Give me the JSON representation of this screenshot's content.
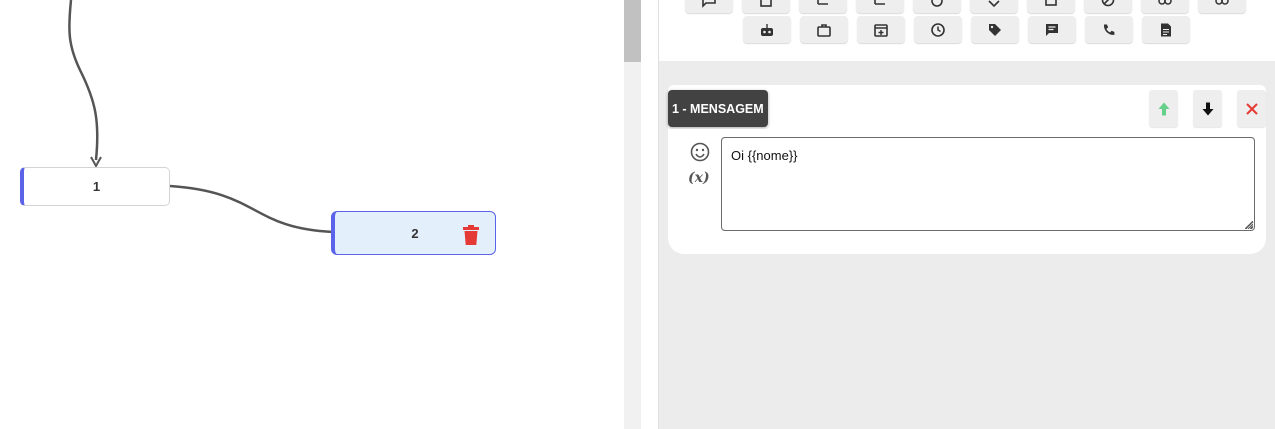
{
  "flow": {
    "nodes": [
      {
        "label": "1"
      },
      {
        "label": "2"
      }
    ]
  },
  "editor": {
    "block_title": "1 - MENSAGEM",
    "message_value": "Oi {{nome}}",
    "variable_label": "(x)"
  },
  "colors": {
    "accent": "#5b63e8",
    "delete_red": "#e53935",
    "up_arrow_green": "#66d08a",
    "chip_bg": "#424242"
  },
  "toolbar": {
    "row1_icons": [
      "chat-bubble-icon",
      "document-icon",
      "branch-icon",
      "branch-icon",
      "timer-icon",
      "tag-outline-icon",
      "code-doc-icon",
      "block-icon",
      "link-icon",
      "link-icon"
    ],
    "row2_icons": [
      "robot-icon",
      "briefcase-icon",
      "calendar-add-icon",
      "clock-icon",
      "tag-icon",
      "message-icon",
      "phone-icon",
      "note-icon"
    ]
  }
}
